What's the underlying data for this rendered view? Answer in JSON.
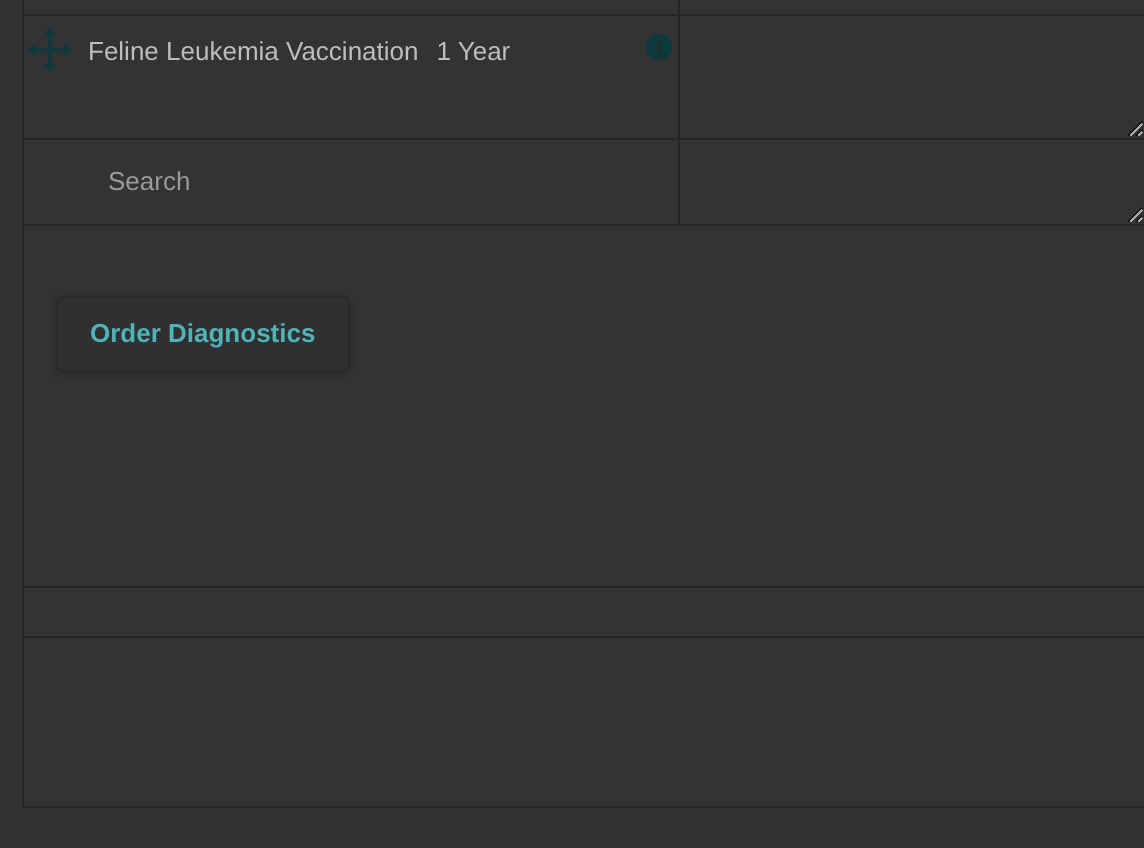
{
  "items": [
    {
      "name": "Feline Leukemia Vaccination",
      "duration": "1 Year"
    }
  ],
  "search": {
    "placeholder": "Search"
  },
  "buttons": [
    "Order Diagnostics"
  ]
}
